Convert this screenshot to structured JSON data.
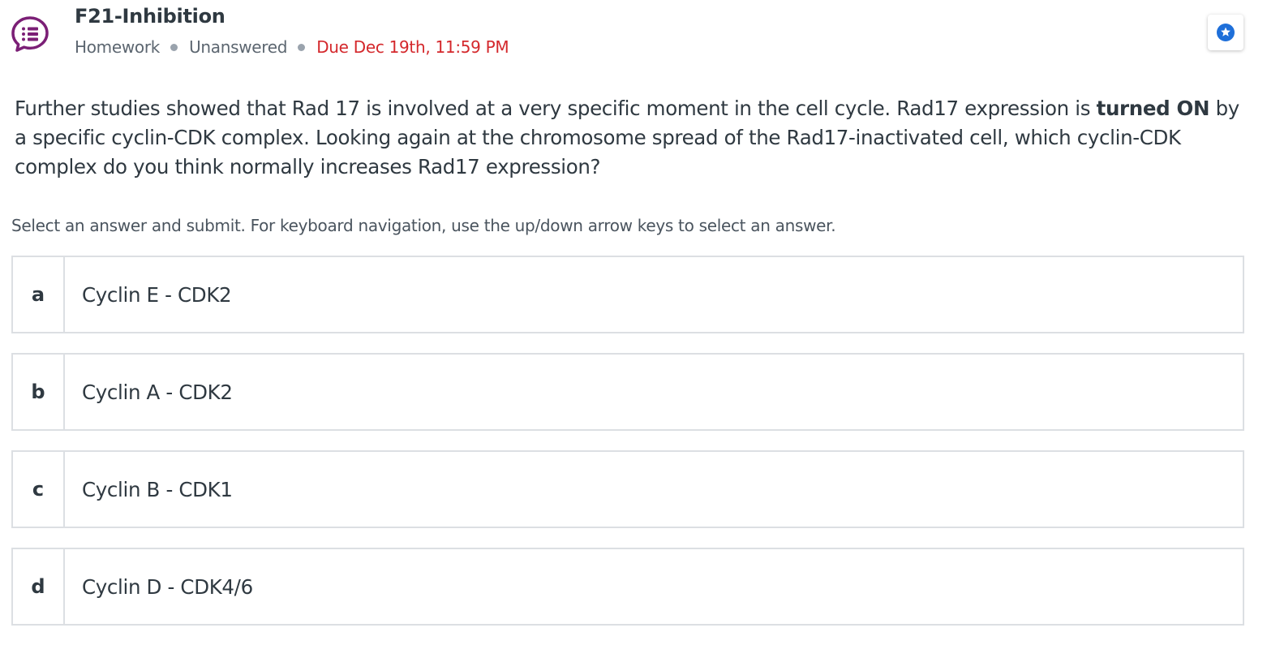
{
  "header": {
    "title": "F21-Inhibition",
    "type": "Homework",
    "status": "Unanswered",
    "due": "Due Dec 19th, 11:59 PM",
    "icon": "multiple-choice-question-icon",
    "star_icon": "star-badge-icon"
  },
  "question": {
    "text_1": "Further studies showed that Rad 17 is involved at a very specific moment in the cell cycle. Rad17 expression is ",
    "emphasis": "turned ON",
    "text_2": " by a specific cyclin-CDK complex. Looking again at the chromosome spread of the Rad17-inactivated cell, which cyclin-CDK complex do you think normally increases Rad17 expression?"
  },
  "instructions": "Select an answer and submit. For keyboard navigation, use the up/down arrow keys to select an answer.",
  "answers": [
    {
      "letter": "a",
      "label": "Cyclin E - CDK2"
    },
    {
      "letter": "b",
      "label": "Cyclin A - CDK2"
    },
    {
      "letter": "c",
      "label": "Cyclin B - CDK1"
    },
    {
      "letter": "d",
      "label": "Cyclin D - CDK4/6"
    }
  ],
  "colors": {
    "icon_purple": "#7b1f76",
    "due_red": "#d4282c",
    "star_blue": "#1e6fd9",
    "border": "#dcdfe3",
    "text": "#2f3941"
  }
}
